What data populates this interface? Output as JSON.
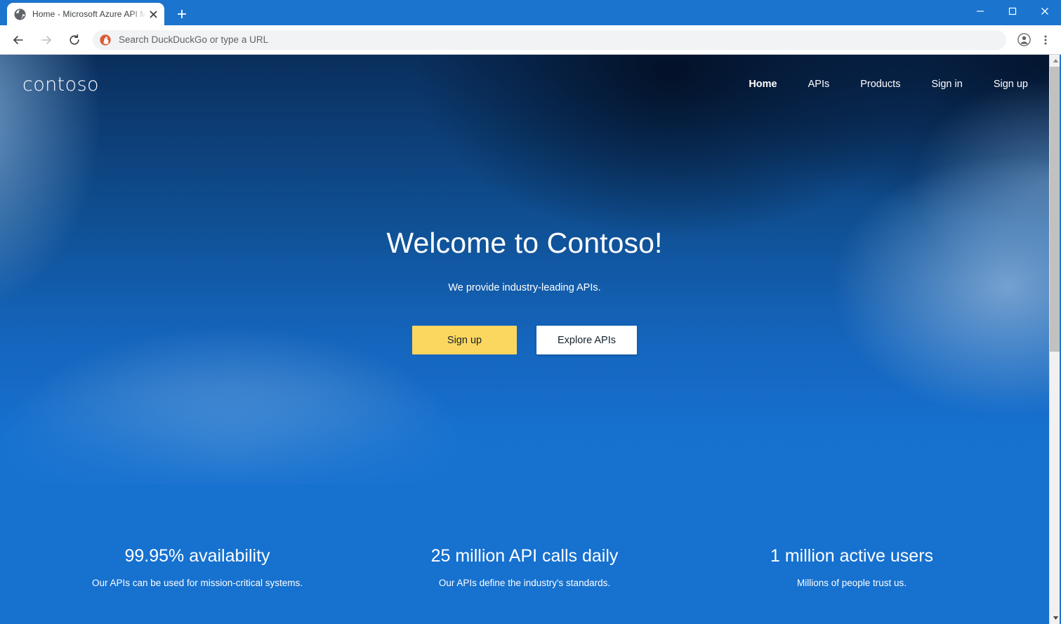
{
  "browser": {
    "tab": {
      "title": "Home - Microsoft Azure API Man",
      "favicon": "globe-icon",
      "close": "×"
    },
    "newtab_label": "+",
    "window_controls": {
      "minimize": "–",
      "maximize": "□",
      "close": "✕"
    },
    "toolbar": {
      "back": "←",
      "forward": "→",
      "reload": "⟳",
      "omnibox_placeholder": "Search DuckDuckGo or type a URL",
      "omnibox_value": "",
      "search_engine_icon": "duckduckgo-icon",
      "profile_icon": "profile-avatar-icon",
      "menu_icon": "three-dot-menu-icon"
    },
    "scrollbar": {
      "up_arrow": "▲",
      "down_arrow": "▼"
    }
  },
  "site": {
    "logo": "contoso",
    "nav": [
      {
        "label": "Home",
        "active": true
      },
      {
        "label": "APIs",
        "active": false
      },
      {
        "label": "Products",
        "active": false
      },
      {
        "label": "Sign in",
        "active": false
      },
      {
        "label": "Sign up",
        "active": false
      }
    ],
    "hero": {
      "title": "Welcome to Contoso!",
      "subtitle": "We provide industry-leading APIs.",
      "primary_cta": "Sign up",
      "secondary_cta": "Explore APIs"
    },
    "stats": [
      {
        "value": "99.95% availability",
        "description": "Our APIs can be used for mission-critical systems."
      },
      {
        "value": "25 million API calls daily",
        "description": "Our APIs define the industry's standards."
      },
      {
        "value": "1 million active users",
        "description": "Millions of people trust us."
      }
    ],
    "colors": {
      "accent_yellow": "#FBD75F",
      "brand_blue": "#1671CF",
      "hero_dark": "#0A2E5C",
      "chrome_blue": "#1B74CE"
    }
  }
}
